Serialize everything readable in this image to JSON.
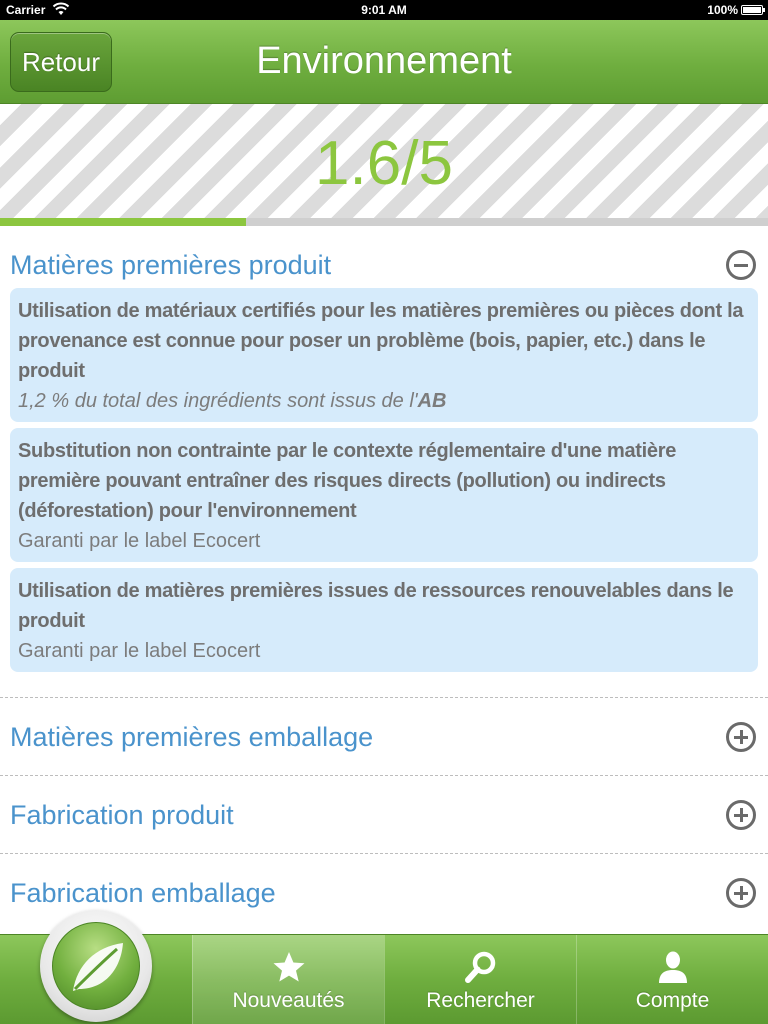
{
  "status_bar": {
    "carrier": "Carrier",
    "time": "9:01 AM",
    "battery": "100%"
  },
  "nav": {
    "back_label": "Retour",
    "title": "Environnement"
  },
  "score": {
    "text": "1.6/5",
    "value": 1.6,
    "max": 5
  },
  "sections": [
    {
      "title": "Matières premières produit",
      "expanded": true,
      "criteria": [
        {
          "title": "Utilisation de matériaux certifiés pour les matières premières ou pièces dont la provenance est connue pour poser un problème (bois, papier, etc.) dans le produit",
          "detail": "1,2 % du total des ingrédients sont issus de l'",
          "detail_bold": "AB"
        },
        {
          "title": "Substitution non contrainte par le contexte réglementaire d'une matière première pouvant entraîner des risques directs (pollution) ou indirects (déforestation) pour l'environnement",
          "detail": "Garanti par le label Ecocert"
        },
        {
          "title": "Utilisation de matières premières issues de ressources renouvelables dans le produit",
          "detail": "Garanti par le label Ecocert"
        }
      ]
    },
    {
      "title": "Matières premières emballage",
      "expanded": false
    },
    {
      "title": "Fabrication produit",
      "expanded": false
    },
    {
      "title": "Fabrication emballage",
      "expanded": false
    }
  ],
  "tabs": [
    {
      "label": "Nouveautés",
      "icon": "star-icon",
      "active": true
    },
    {
      "label": "Rechercher",
      "icon": "search-icon",
      "active": false
    },
    {
      "label": "Compte",
      "icon": "user-icon",
      "active": false
    }
  ],
  "colors": {
    "accent_green": "#8cc63f",
    "section_blue": "#4a93cc",
    "card_blue": "#d6ebfb"
  }
}
